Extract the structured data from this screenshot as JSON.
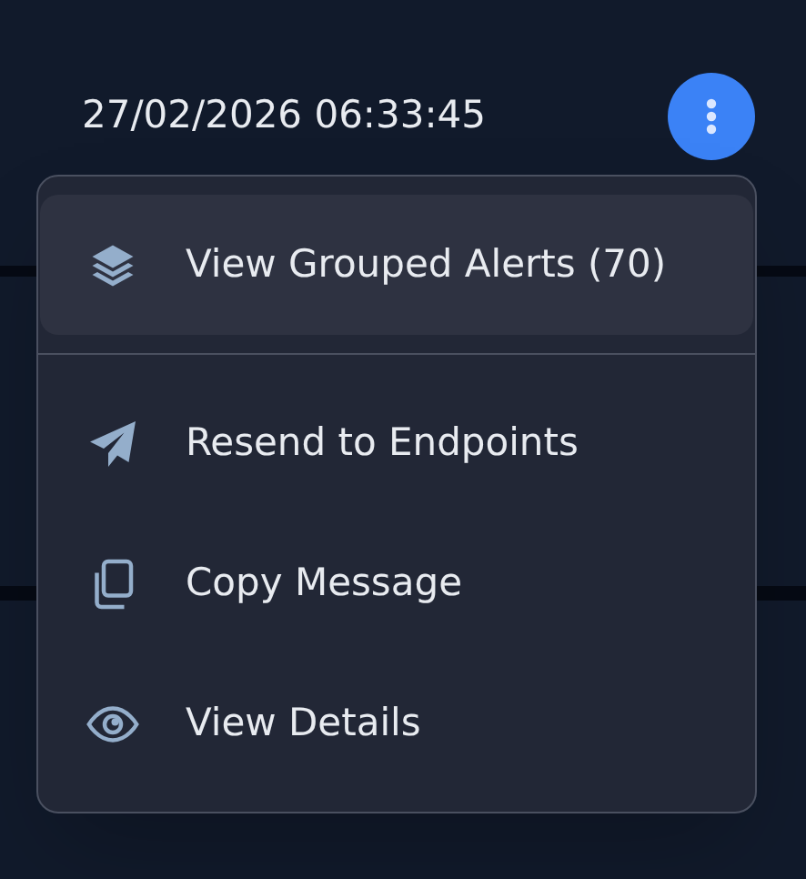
{
  "header": {
    "timestamp": "27/02/2026 06:33:45"
  },
  "menu": {
    "items": [
      {
        "kind": "item",
        "label": "View Grouped Alerts (70)",
        "highlighted": true
      },
      {
        "kind": "divider"
      },
      {
        "kind": "item",
        "label": "Resend to Endpoints",
        "highlighted": false
      },
      {
        "kind": "item",
        "label": "Copy Message",
        "highlighted": false
      },
      {
        "kind": "item",
        "label": "View Details",
        "highlighted": false
      }
    ]
  }
}
